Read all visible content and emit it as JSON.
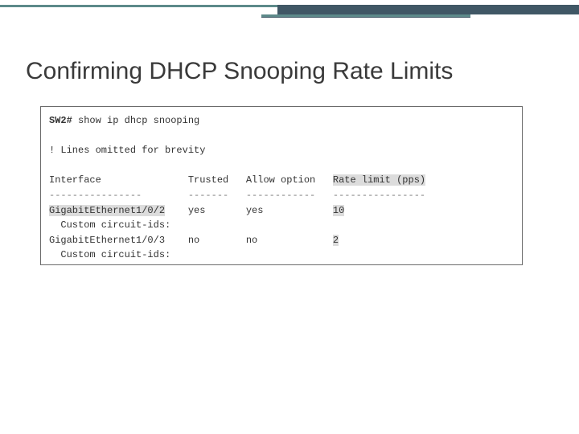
{
  "title": "Confirming DHCP Snooping Rate Limits",
  "cli": {
    "prompt": "SW2# ",
    "command": "show ip dhcp snooping",
    "omitted": "! Lines omitted for brevity",
    "headers": {
      "iface": "Interface",
      "trusted": "Trusted",
      "allow": "Allow option",
      "rate": "Rate limit (pps)"
    },
    "rows": [
      {
        "iface": "GigabitEthernet1/0/2",
        "trusted": "yes",
        "allow": "yes",
        "rate": "10",
        "hl_iface": true,
        "hl_rate": true
      },
      {
        "iface": "GigabitEthernet1/0/3",
        "trusted": "no",
        "allow": "no",
        "rate": "2",
        "hl_iface": false,
        "hl_rate": true
      }
    ],
    "sub": "  Custom circuit-ids:",
    "dash": {
      "iface": "----------------",
      "trusted": "-------",
      "allow": "------------",
      "rate": "----------------"
    }
  }
}
